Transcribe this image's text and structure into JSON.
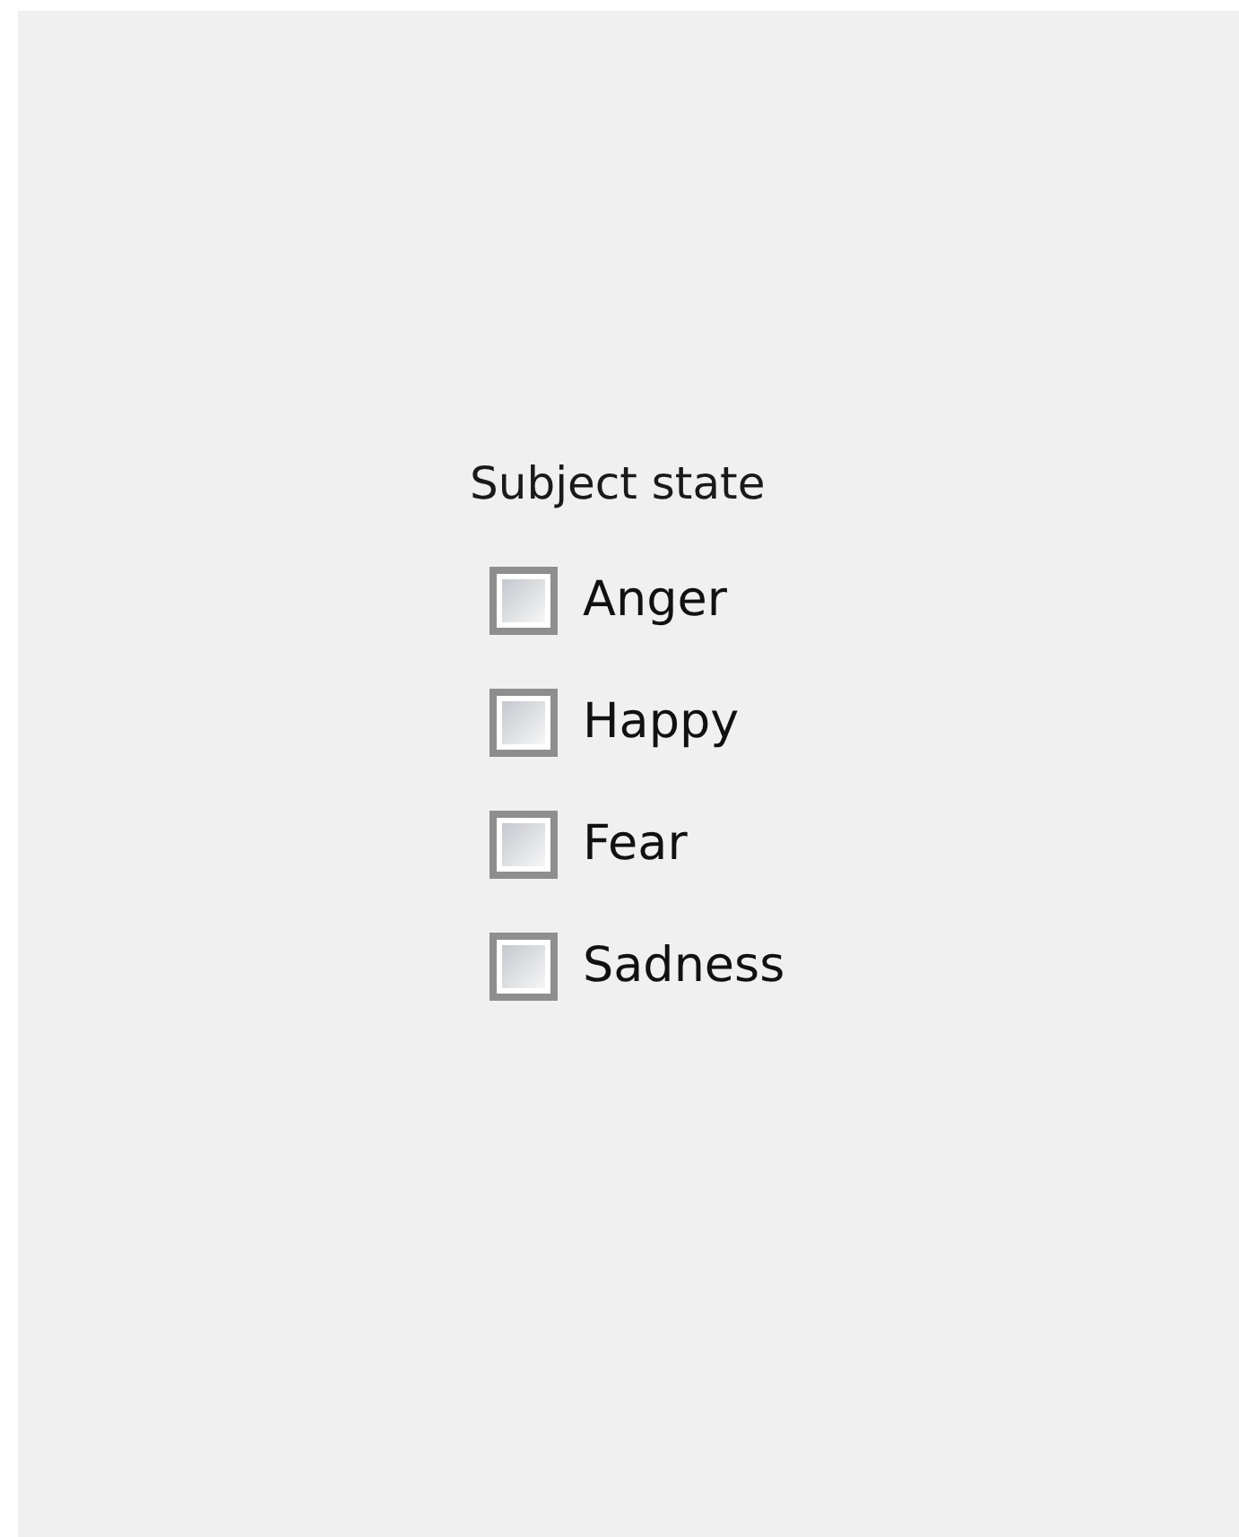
{
  "group": {
    "title": "Subject state",
    "options": [
      {
        "label": "Anger",
        "checked": false
      },
      {
        "label": "Happy",
        "checked": false
      },
      {
        "label": "Fear",
        "checked": false
      },
      {
        "label": "Sadness",
        "checked": false
      }
    ]
  }
}
